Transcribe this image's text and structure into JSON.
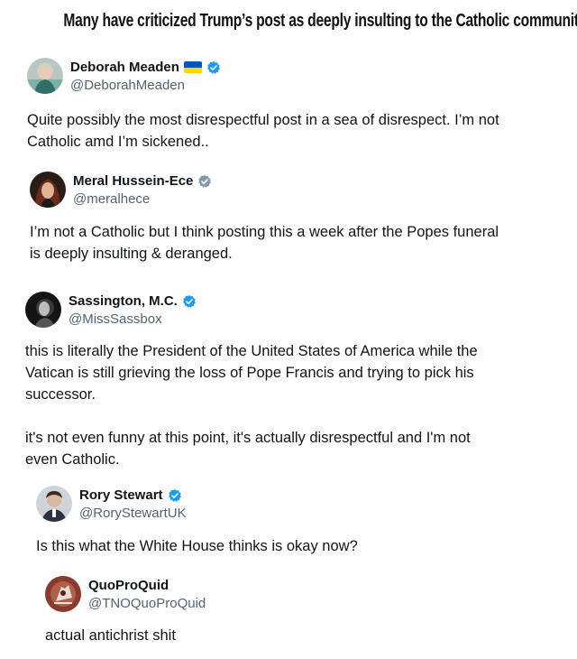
{
  "headline": "Many have criticized Trump’s post as deeply insulting to the Catholic community",
  "colors": {
    "verified_blue": "#1d9bf0",
    "verified_grey": "#829aab",
    "name_text": "#0f1419",
    "handle_text": "#536471",
    "flag_blue": "#0057b7",
    "flag_yellow": "#ffd700"
  },
  "posts": [
    {
      "name": "Deborah Meaden",
      "handle": "@DeborahMeaden",
      "badge": "verified-blue",
      "extra_icon": "ukraine-flag-icon",
      "text": "Quite possibly the most disrespectful post in a sea of disrespect. I’m not\nCatholic amd I’m sickened.."
    },
    {
      "name": "Meral Hussein-Ece",
      "handle": "@meralhece",
      "badge": "verified-grey",
      "text": "I’m not a Catholic but I think posting this a week after the Popes funeral\nis deeply insulting & deranged."
    },
    {
      "name": "Sassington, M.C.",
      "handle": "@MissSassbox",
      "badge": "verified-blue",
      "text": "this is literally the President of the United States of America while the\nVatican is still grieving the loss of Pope Francis and trying to pick his\nsuccessor.\n\nit's not even funny at this point, it's actually disrespectful and I'm not\neven Catholic."
    },
    {
      "name": "Rory Stewart",
      "handle": "@RoryStewartUK",
      "badge": "verified-blue",
      "text": "Is this what the White House thinks is okay now?"
    },
    {
      "name": "QuoProQuid",
      "handle": "@TNOQuoProQuid",
      "badge": "none",
      "text": "actual antichrist shit"
    }
  ]
}
